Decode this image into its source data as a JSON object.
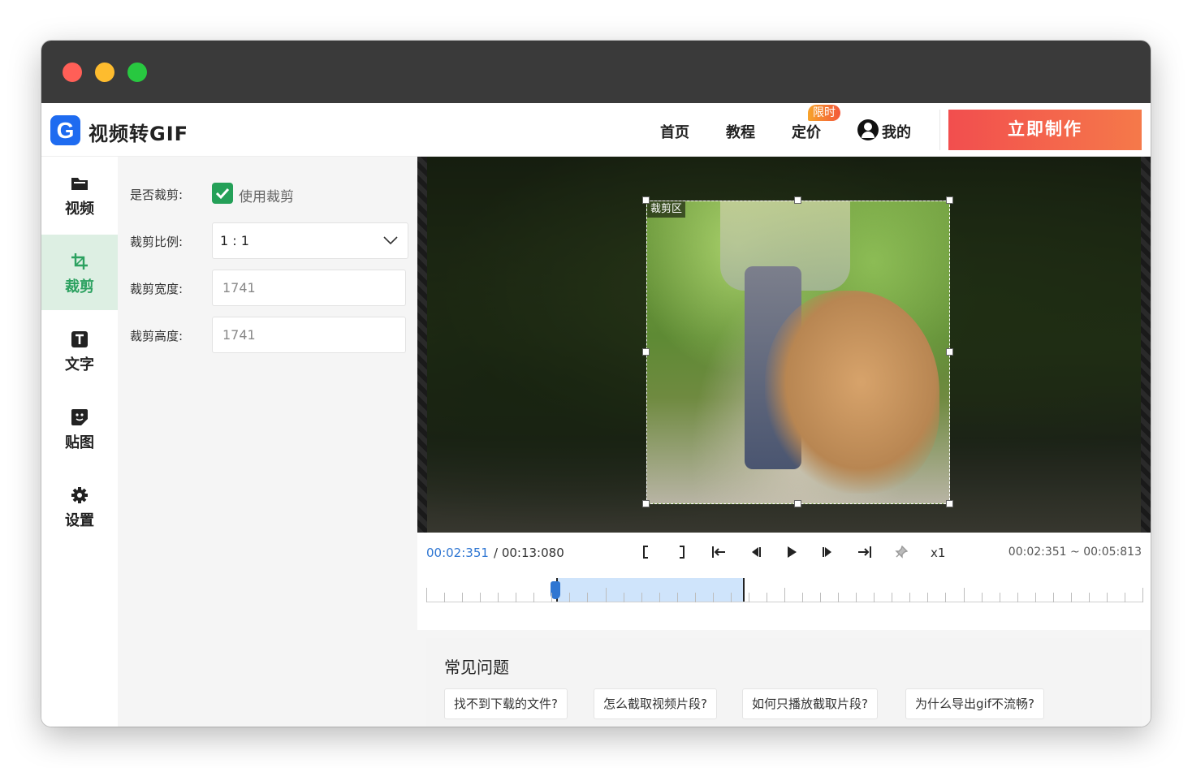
{
  "app": {
    "logo_letter": "G",
    "name": "视频转GIF"
  },
  "nav": {
    "home": "首页",
    "tutorial": "教程",
    "pricing": "定价",
    "pricing_badge": "限时",
    "mine": "我的",
    "cta": "立即制作"
  },
  "sidebar": {
    "items": [
      {
        "label": "视频",
        "icon": "folder-icon"
      },
      {
        "label": "裁剪",
        "icon": "crop-icon",
        "active": true
      },
      {
        "label": "文字",
        "icon": "text-icon"
      },
      {
        "label": "贴图",
        "icon": "sticker-icon"
      },
      {
        "label": "设置",
        "icon": "gear-icon"
      }
    ]
  },
  "crop_settings": {
    "enable_label": "是否裁剪:",
    "enable_checkbox_label": "使用裁剪",
    "enabled": true,
    "ratio_label": "裁剪比例:",
    "ratio_value": "1 : 1",
    "width_label": "裁剪宽度:",
    "width_value": "1741",
    "height_label": "裁剪高度:",
    "height_value": "1741"
  },
  "preview": {
    "crop_tag": "裁剪区"
  },
  "player": {
    "current_time": "00:02:351",
    "total_time": "/ 00:13:080",
    "speed": "x1",
    "range": "00:02:351 ~ 00:05:813",
    "controls": [
      "set-start-icon",
      "set-end-icon",
      "jump-to-start-icon",
      "prev-frame-icon",
      "play-icon",
      "next-frame-icon",
      "jump-to-end-icon",
      "pin-icon"
    ]
  },
  "faq": {
    "title": "常见问题",
    "questions": [
      "找不到下载的文件?",
      "怎么截取视频片段?",
      "如何只播放截取片段?",
      "为什么导出gif不流畅?"
    ]
  },
  "colors": {
    "accent_green": "#24a058",
    "cta_start": "#f24e4e",
    "cta_end": "#f5794a",
    "time_blue": "#2f76d2"
  }
}
